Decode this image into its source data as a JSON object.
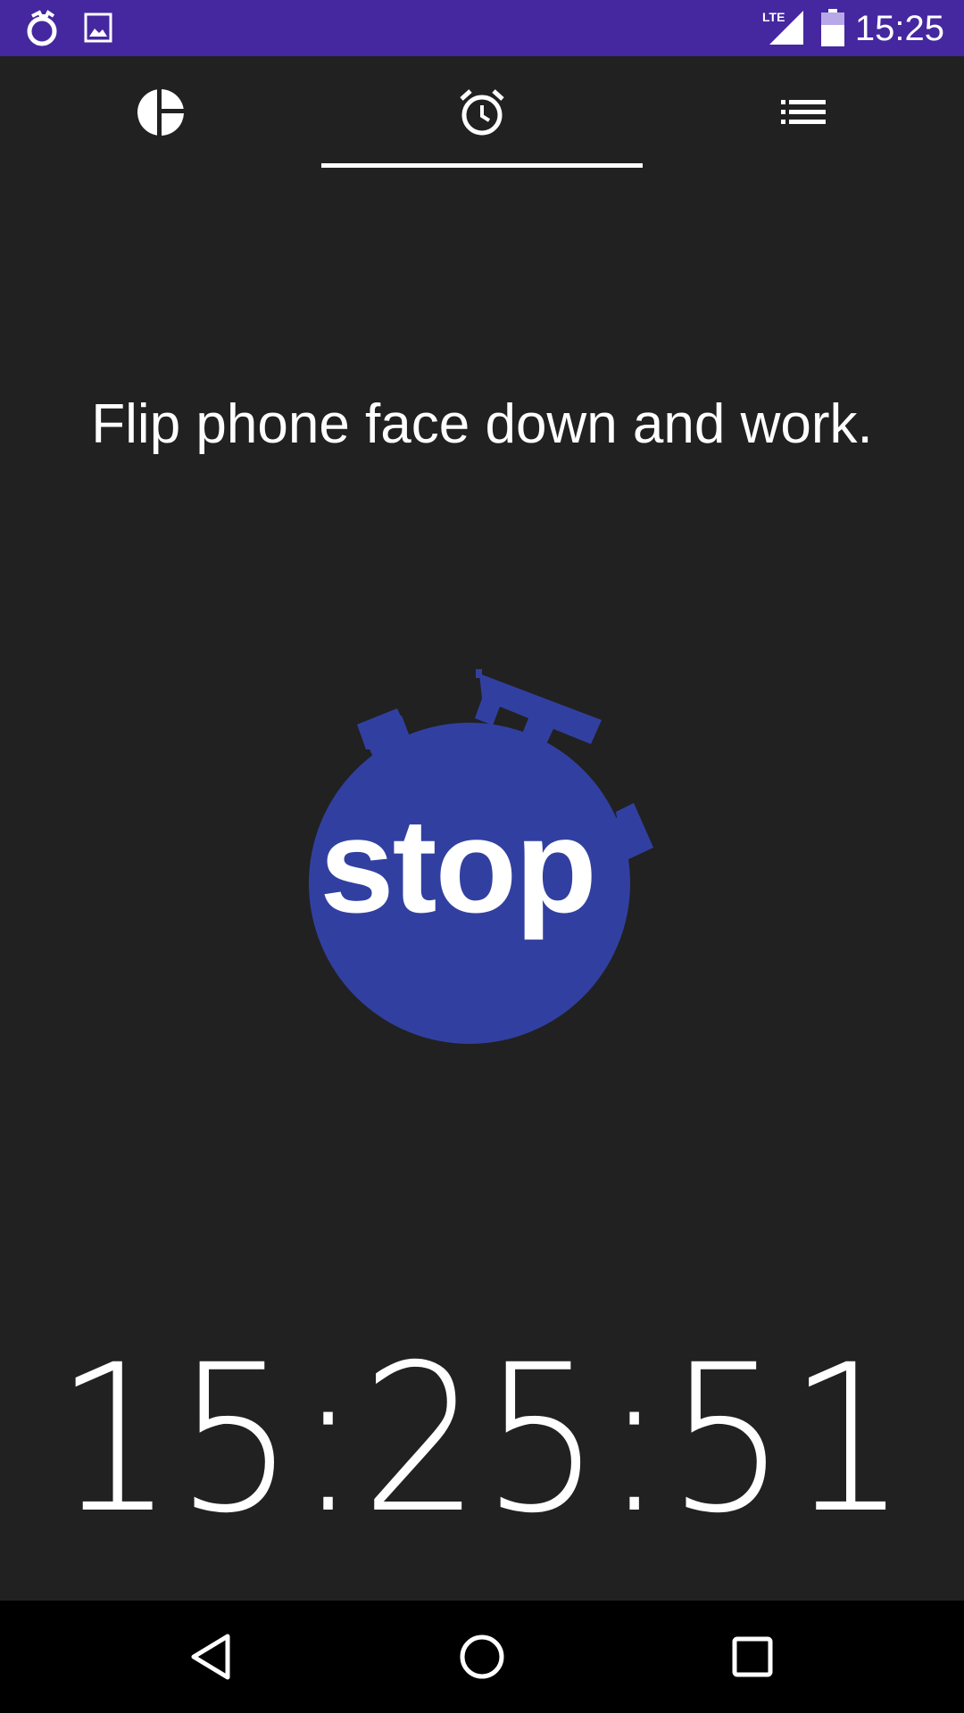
{
  "status_bar": {
    "time": "15:25",
    "network": "LTE",
    "left_icons": [
      "stopwatch-icon",
      "image-icon"
    ],
    "right_icons": [
      "lte-signal-icon",
      "battery-icon"
    ],
    "background": "#4527A0"
  },
  "tabs": [
    {
      "name": "stats",
      "icon": "pie-chart-icon",
      "selected": false
    },
    {
      "name": "timer",
      "icon": "alarm-clock-icon",
      "selected": true
    },
    {
      "name": "list",
      "icon": "list-icon",
      "selected": false
    }
  ],
  "main": {
    "instruction": "Flip phone face down and work.",
    "stop_label": "stop",
    "stop_color": "#3140A0",
    "clock": "15:25:51"
  },
  "nav_bar": {
    "icons": [
      "back-icon",
      "home-icon",
      "recents-icon"
    ]
  },
  "colors": {
    "background": "#212121",
    "accent": "#3140A0"
  }
}
